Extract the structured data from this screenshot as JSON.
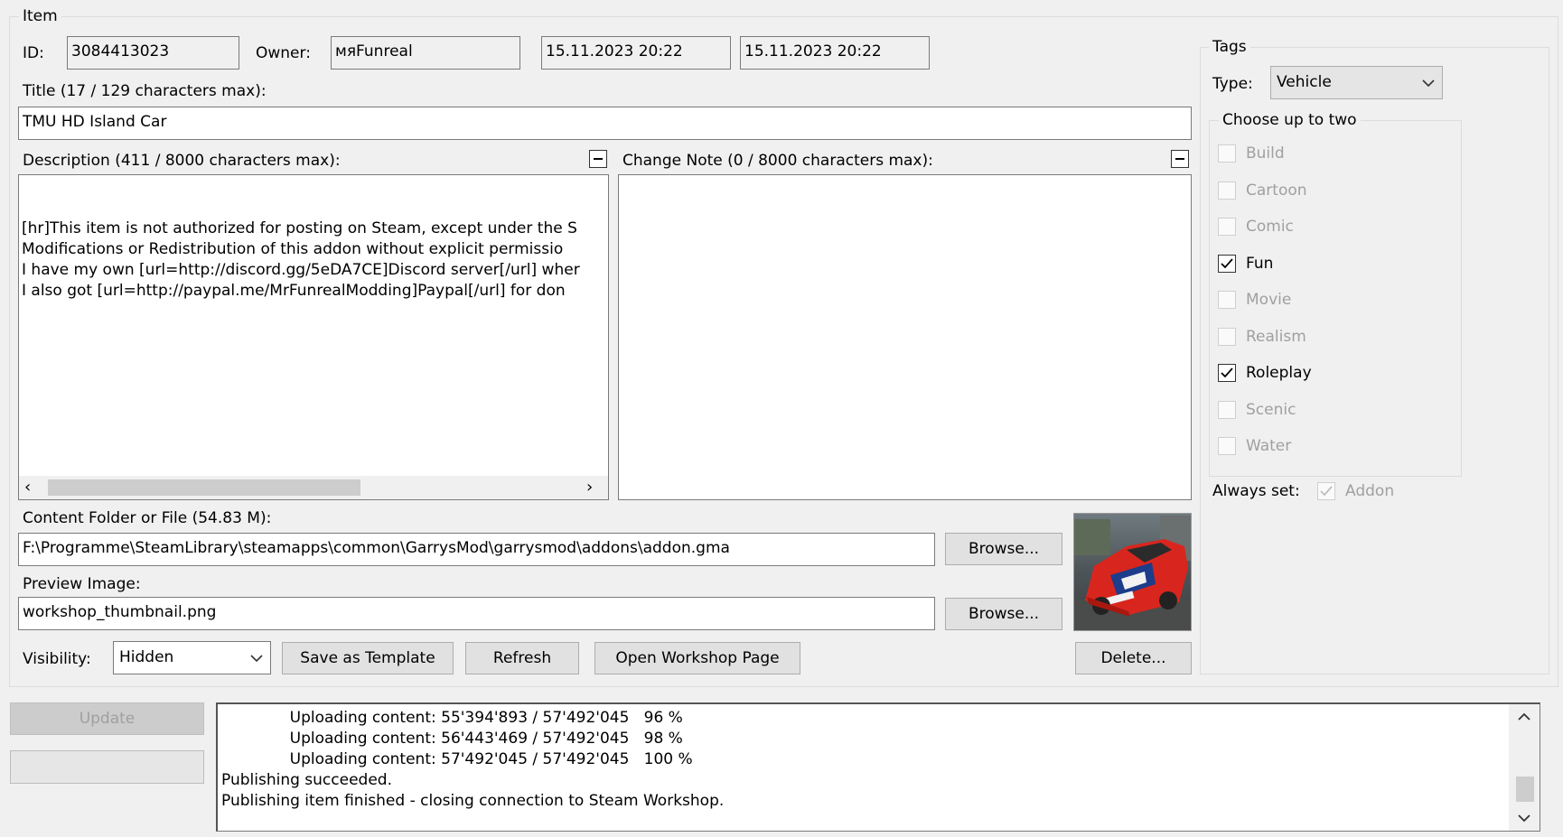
{
  "item_group": {
    "legend": "Item",
    "id_label": "ID:",
    "id_value": "3084413023",
    "owner_label": "Owner:",
    "owner_value": "мяFunreal",
    "created": "15.11.2023 20:22",
    "updated": "15.11.2023 20:22",
    "title_label": "Title (17 / 129 characters max):",
    "title_value": "TMU HD Island Car",
    "description_label": "Description (411 / 8000 characters max):",
    "description_lines": [
      "[hr]This item is not authorized for posting on Steam, except under the S",
      "Modifications or Redistribution of this addon without explicit permissio",
      "I have my own [url=http://discord.gg/5eDA7CE]Discord server[/url] wher",
      "I also got [url=http://paypal.me/MrFunrealModding]Paypal[/url] for don"
    ],
    "change_note_label": "Change Note (0 / 8000 characters max):",
    "change_note_value": "",
    "content_label": "Content Folder or File (54.83 M):",
    "content_value": "F:\\Programme\\SteamLibrary\\steamapps\\common\\GarrysMod\\garrysmod\\addons\\addon.gma",
    "browse_label": "Browse...",
    "preview_label": "Preview Image:",
    "preview_value": "workshop_thumbnail.png",
    "visibility_label": "Visibility:",
    "visibility_value": "Hidden",
    "save_template_label": "Save as Template",
    "refresh_label": "Refresh",
    "open_workshop_label": "Open Workshop Page",
    "delete_label": "Delete..."
  },
  "tags": {
    "legend": "Tags",
    "type_label": "Type:",
    "type_value": "Vehicle",
    "choose_legend": "Choose up to two",
    "options": [
      {
        "label": "Build",
        "checked": false
      },
      {
        "label": "Cartoon",
        "checked": false
      },
      {
        "label": "Comic",
        "checked": false
      },
      {
        "label": "Fun",
        "checked": true
      },
      {
        "label": "Movie",
        "checked": false
      },
      {
        "label": "Realism",
        "checked": false
      },
      {
        "label": "Roleplay",
        "checked": true
      },
      {
        "label": "Scenic",
        "checked": false
      },
      {
        "label": "Water",
        "checked": false
      }
    ],
    "always_set_label": "Always set:",
    "always_set_value": "Addon"
  },
  "bottom": {
    "update_label": "Update",
    "log_lines": [
      "              Uploading content: 55'394'893 / 57'492'045   96 %",
      "              Uploading content: 56'443'469 / 57'492'045   98 %",
      "              Uploading content: 57'492'045 / 57'492'045   100 %",
      "Publishing succeeded.",
      "Publishing item finished - closing connection to Steam Workshop."
    ]
  },
  "colors": {
    "window_bg": "#f0f0f0",
    "car_red": "#d8261f",
    "disabled_text": "#a0a0a0"
  }
}
